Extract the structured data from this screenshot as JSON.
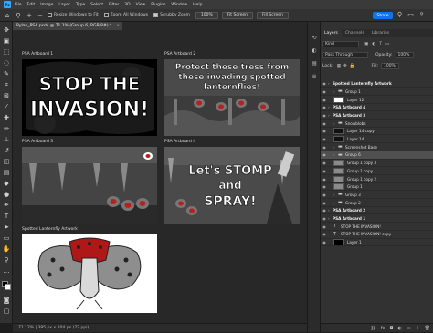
{
  "menubar": {
    "logo": "Ps",
    "items": [
      "File",
      "Edit",
      "Image",
      "Layer",
      "Type",
      "Select",
      "Filter",
      "3D",
      "View",
      "Plugins",
      "Window",
      "Help"
    ]
  },
  "options": {
    "resize_windows": "Resize Windows to Fit",
    "zoom_all_windows": "Zoom All Windows",
    "scrubby_zoom": "Scrubby Zoom",
    "zoom_percent": "100%",
    "fit_screen": "Fit Screen",
    "fill_screen": "Fill Screen",
    "share": "Share"
  },
  "document": {
    "tab_title": "Rylan_PSA.psdc @ 71.1% (Group 6, RGB/8#) *",
    "close_glyph": "×"
  },
  "canvas": {
    "artboards": [
      {
        "label": "PSA Artboard 1",
        "headline_1": "STOP THE",
        "headline_2": "INVASION!"
      },
      {
        "label": "PSA Artboard 2",
        "headline_1": "Protect these tress from",
        "headline_2": "these invading spotted",
        "headline_3": "lanternflies!"
      },
      {
        "label": "PSA Artboard 3"
      },
      {
        "label": "PSA Artboard 4",
        "headline_1": "Let's STOMP",
        "headline_2": "and",
        "headline_3": "SPRAY!"
      },
      {
        "label": "Spotted Lanternfly Artwork"
      }
    ]
  },
  "status": {
    "text": "71.12%  |  395 px x 204 px (72 ppi)"
  },
  "layers_panel": {
    "tabs": [
      "Layers",
      "Channels",
      "Libraries"
    ],
    "filter_placeholder": "Kind",
    "blend_mode": "Pass Through",
    "opacity_label": "Opacity:",
    "opacity_value": "100%",
    "lock_label": "Lock:",
    "fill_label": "Fill:",
    "fill_value": "100%",
    "layers": [
      {
        "name": "Spotted Lanternfly Artwork",
        "kind": "artboard"
      },
      {
        "name": "Group 1",
        "kind": "group"
      },
      {
        "name": "Layer 12",
        "kind": "pixel",
        "thumb": "#ffffff"
      },
      {
        "name": "PSA Artboard 4",
        "kind": "artboard"
      },
      {
        "name": "PSA Artboard 3",
        "kind": "artboard"
      },
      {
        "name": "Snowblobs",
        "kind": "group"
      },
      {
        "name": "Layer 14 copy",
        "kind": "pixel",
        "thumb": "#111111"
      },
      {
        "name": "Layer 14",
        "kind": "pixel",
        "thumb": "#111111"
      },
      {
        "name": "Screenshot Base",
        "kind": "group"
      },
      {
        "name": "Group 6",
        "kind": "group",
        "selected": true
      },
      {
        "name": "Group 1 copy 3",
        "kind": "pixel",
        "thumb": "#8a8a8a"
      },
      {
        "name": "Group 1 copy",
        "kind": "pixel",
        "thumb": "#8a8a8a"
      },
      {
        "name": "Group 1 copy 2",
        "kind": "pixel",
        "thumb": "#8a8a8a"
      },
      {
        "name": "Group 1",
        "kind": "pixel",
        "thumb": "#8a8a8a"
      },
      {
        "name": "Group 3",
        "kind": "group"
      },
      {
        "name": "Group 2",
        "kind": "group"
      },
      {
        "name": "PSA Artboard 2",
        "kind": "artboard"
      },
      {
        "name": "PSA Artboard 1",
        "kind": "artboard"
      },
      {
        "name": "STOP THE INVASION!",
        "kind": "text"
      },
      {
        "name": "STOP THE INVASION! copy",
        "kind": "text"
      },
      {
        "name": "Layer 1",
        "kind": "pixel",
        "thumb": "#000000"
      }
    ]
  },
  "colors": {
    "accent": "#1473e6",
    "app_bg": "#1e1e1e",
    "panel_bg": "#323232",
    "lanternfly_red": "#c22020"
  }
}
